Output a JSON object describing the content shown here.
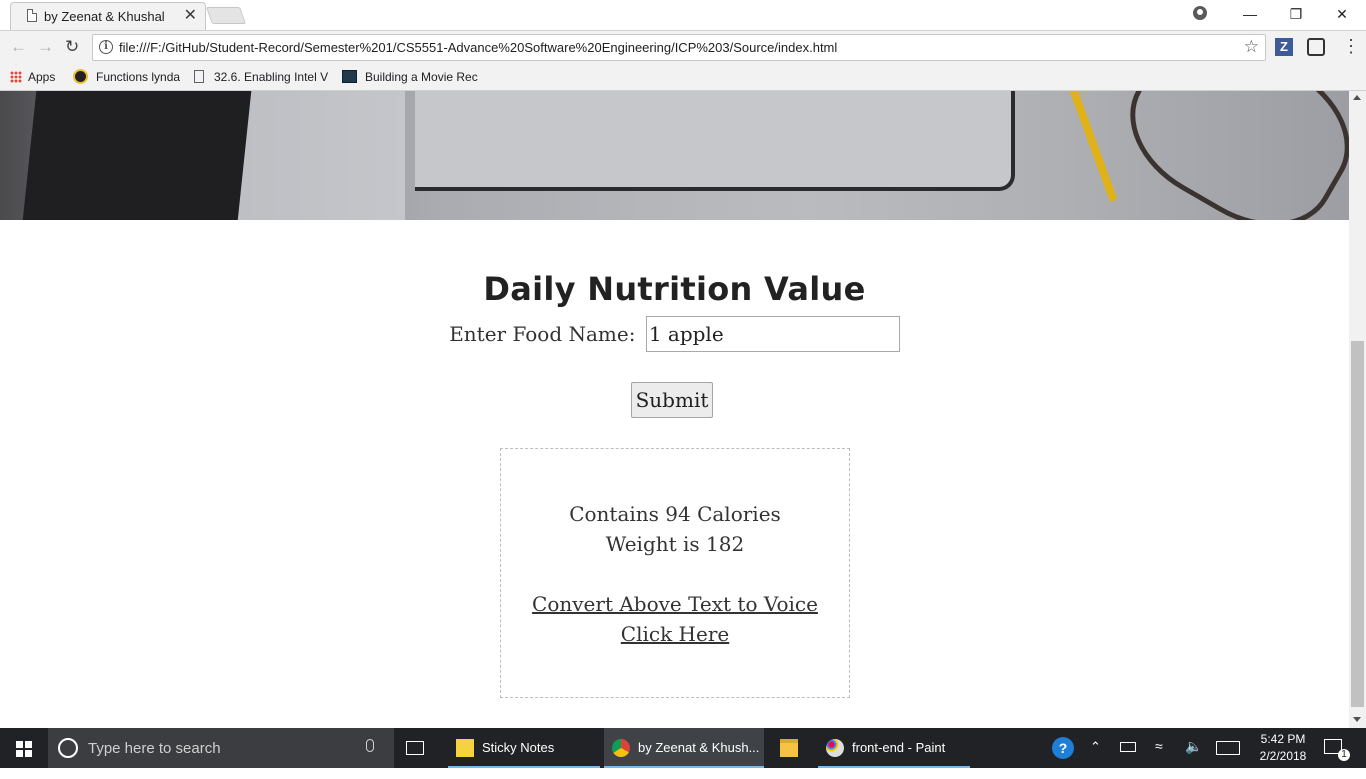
{
  "browser": {
    "tab_title": "by Zeenat & Khushal",
    "tab_close": "✕",
    "url": "file:///F:/GitHub/Student-Record/Semester%201/CS5551-Advance%20Software%20Engineering/ICP%203/Source/index.html",
    "window_controls": {
      "minimize": "—",
      "restore": "❐",
      "close": "✕"
    },
    "bookmarks": [
      {
        "label": "Apps",
        "icon": "apps-grid-icon"
      },
      {
        "label": "Functions lynda",
        "icon": "lynda-icon"
      },
      {
        "label": "32.6. Enabling Intel V",
        "icon": "page-icon"
      },
      {
        "label": "Building a Movie Rec",
        "icon": "monitor-icon"
      }
    ]
  },
  "page": {
    "heading": "Daily Nutrition Value",
    "food_label": "Enter Food Name:",
    "food_value": "1 apple",
    "submit_label": "Submit",
    "result": {
      "calories_text": "Contains 94 Calories",
      "weight_text": "Weight is 182",
      "voice_link": "Convert Above Text to Voice",
      "click_link": "Click Here"
    }
  },
  "taskbar": {
    "search_placeholder": "Type here to search",
    "apps": [
      {
        "label": "Sticky Notes",
        "icon": "sticky-notes-icon"
      },
      {
        "label": "by Zeenat & Khush...",
        "icon": "chrome-icon",
        "active": true
      },
      {
        "label": "",
        "icon": "file-explorer-icon"
      },
      {
        "label": "front-end - Paint",
        "icon": "paint-icon"
      }
    ],
    "time": "5:42 PM",
    "date": "2/2/2018",
    "notification_count": "1"
  }
}
